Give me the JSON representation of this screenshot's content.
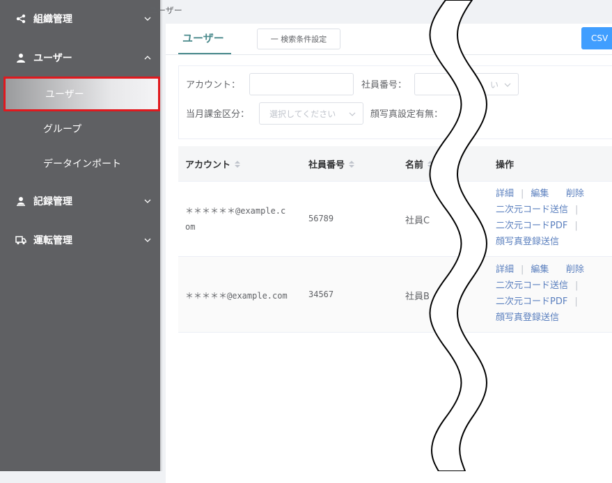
{
  "sidebar": {
    "menus": [
      {
        "label": "組織管理",
        "icon": "share-icon",
        "expanded": false
      },
      {
        "label": "ユーザー",
        "icon": "user-icon",
        "expanded": true
      },
      {
        "label": "記録管理",
        "icon": "user-record-icon",
        "expanded": false
      },
      {
        "label": "運転管理",
        "icon": "truck-icon",
        "expanded": false
      }
    ],
    "sub_items": [
      "ユーザー",
      "グループ",
      "データインポート"
    ],
    "active_sub": "ユーザー"
  },
  "breadcrumb": "ユーザー",
  "tabs": {
    "active": "ユーザー"
  },
  "toolbar": {
    "search_condition_label": "一 検索条件設定",
    "csv_label": "CSV"
  },
  "filters": {
    "account_label": "アカウント：",
    "account_value": "",
    "employee_no_label": "社員番号：",
    "employee_no_placeholder": "い",
    "billing_label": "当月課金区分：",
    "billing_placeholder": "選択してください",
    "face_photo_label": "顔写真設定有無："
  },
  "table": {
    "columns": [
      "アカウント",
      "社員番号",
      "名前",
      "操作"
    ],
    "rows": [
      {
        "account": "＊＊＊＊＊＊@example.c",
        "account2": "om",
        "employee_no": "56789",
        "name": "社員C"
      },
      {
        "account": "＊＊＊＊＊@example.com",
        "account2": "",
        "employee_no": "34567",
        "name": "社員B"
      }
    ],
    "actions": {
      "detail": "詳細",
      "edit": "編集",
      "delete": "削除",
      "qr_send": "二次元コード送信",
      "qr_pdf": "二次元コードPDF",
      "face_send": "顔写真登録送信"
    }
  },
  "colors": {
    "sidebar_bg": "#5f6063",
    "accent": "#4a8a8c",
    "primary": "#409eff",
    "link": "#5a7fbe",
    "highlight_border": "#e0191e"
  }
}
